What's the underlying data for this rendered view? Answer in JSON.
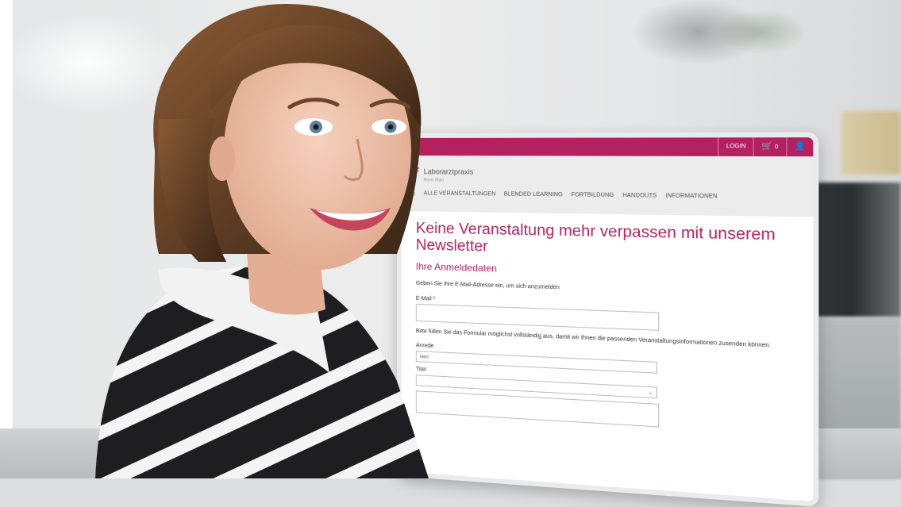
{
  "colors": {
    "brand": "#b4215f",
    "background": "#e6e7e8"
  },
  "topbar": {
    "login": "LOGIN",
    "cart_count": "0",
    "cart_icon": "cart-icon",
    "user_icon": "user-icon"
  },
  "logo": {
    "name": "Laborarztpraxis",
    "tagline": "Rhein Main"
  },
  "nav": {
    "home_icon": "home-icon",
    "items": [
      "ALLE VERANSTALTUNGEN",
      "BLENDED LEARNING",
      "FORTBILDUNG",
      "HANDOUTS",
      "INFORMATIONEN"
    ]
  },
  "form": {
    "headline": "Keine Veranstaltung mehr verpassen mit unserem Newsletter",
    "subhead": "Ihre Anmeldedaten",
    "intro": "Geben Sie Ihre E-Mail-Adresse ein, um sich anzumelden",
    "email_label": "E-Mail *",
    "info": "Bitte füllen Sie das Formular möglichst vollständig aus, damit wir Ihnen die passenden Veranstaltungsinformationen zusenden können.",
    "anrede_label": "Anrede",
    "anrede_value": "Herr",
    "titel_label": "Titel"
  }
}
